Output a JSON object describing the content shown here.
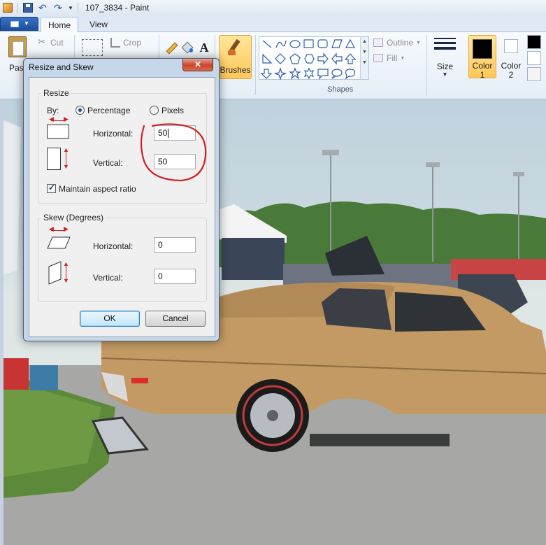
{
  "window": {
    "title": "107_3834 - Paint"
  },
  "ribbon": {
    "tabs": [
      {
        "label": "Home"
      },
      {
        "label": "View"
      }
    ],
    "clipboard": {
      "paste": "Pas",
      "cut": "Cut"
    },
    "image": {
      "crop": "Crop"
    },
    "brushes": "Brushes",
    "shapes": {
      "label": "Shapes",
      "outline": "Outline",
      "fill": "Fill"
    },
    "size": "Size",
    "color1": {
      "line1": "Color",
      "line2": "1",
      "value": "#000000"
    },
    "color2": {
      "line1": "Color",
      "line2": "2",
      "value": "#ffffff"
    }
  },
  "dialog": {
    "title": "Resize and Skew",
    "close_label": "✕",
    "resize": {
      "group_title": "Resize",
      "by_label": "By:",
      "option_percentage": "Percentage",
      "option_pixels": "Pixels",
      "selected": "Percentage",
      "horizontal_label": "Horizontal:",
      "horizontal_value": "50",
      "vertical_label": "Vertical:",
      "vertical_value": "50",
      "maintain_aspect": "Maintain aspect ratio",
      "maintain_aspect_checked": true
    },
    "skew": {
      "group_title": "Skew (Degrees)",
      "horizontal_label": "Horizontal:",
      "horizontal_value": "0",
      "vertical_label": "Vertical:",
      "vertical_value": "0"
    },
    "ok_label": "OK",
    "cancel_label": "Cancel"
  },
  "colors": {
    "annotation": "#d42020",
    "accent": "#ffc85b"
  }
}
